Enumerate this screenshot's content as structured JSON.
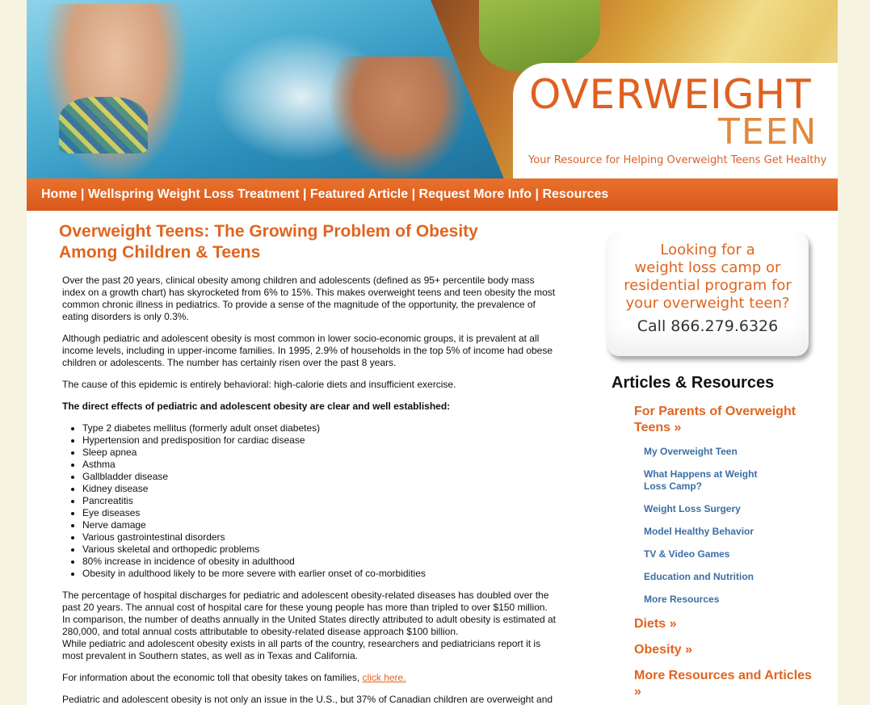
{
  "header": {
    "logo_title": "OVERWEIGHT",
    "logo_subtitle": "TEEN",
    "tagline": "Your Resource for Helping Overweight Teens Get Healthy"
  },
  "nav": {
    "items": [
      "Home",
      "Wellspring Weight Loss Treatment",
      "Featured Article",
      "Request More Info",
      "Resources"
    ],
    "separator": "|"
  },
  "main": {
    "title": "Overweight Teens: The Growing Problem of Obesity Among Children & Teens",
    "p1": "Over the past 20 years, clinical obesity among children and adolescents (defined as 95+ percentile body mass index on a growth chart) has skyrocketed from 6% to 15%. This makes overweight teens and teen obesity the most common chronic illness in pediatrics. To provide a sense of the magnitude of the opportunity, the prevalence of eating disorders is only 0.3%.",
    "p2": "Although pediatric and adolescent obesity is most common in lower socio-economic groups, it is prevalent at all income levels, including in upper-income families. In 1995, 2.9% of households in the top 5% of income had obese children or adolescents. The number has certainly risen over the past 8 years.",
    "p3": "The cause of this epidemic is entirely behavioral: high-calorie diets and insufficient exercise.",
    "list_lead": "The direct effects of pediatric and adolescent obesity are clear and well established:",
    "effects": [
      "Type 2 diabetes mellitus (formerly adult onset diabetes)",
      "Hypertension and predisposition for cardiac disease",
      "Sleep apnea",
      "Asthma",
      "Gallbladder disease",
      "Kidney disease",
      "Pancreatitis",
      "Eye diseases",
      "Nerve damage",
      "Various gastrointestinal disorders",
      "Various skeletal and orthopedic problems",
      "80% increase in incidence of obesity in adulthood",
      "Obesity in adulthood likely to be more severe with earlier onset of co-morbidities"
    ],
    "p4a": "The percentage of hospital discharges for pediatric and adolescent obesity-related diseases has doubled over the past 20 years. The annual cost of hospital care for these young people has more than tripled to over $150 million. In comparison, the number of deaths annually in the United States directly attributed to adult obesity is estimated at 280,000, and total annual costs attributable to obesity-related disease approach $100 billion.",
    "p4b": "While pediatric and adolescent obesity exists in all parts of the country, researchers and pediatricians report it is most prevalent in Southern states, as well as in Texas and California.",
    "p5_text": "For information about the economic toll that obesity takes on families,",
    "p5_link": "click here.",
    "p6": "Pediatric and adolescent obesity is not only an issue in the U.S., but 37% of Canadian children are overweight and"
  },
  "sidebar": {
    "promo_lines": [
      "Looking for a",
      "weight loss camp or",
      "residential program for",
      "your overweight teen?"
    ],
    "promo_phone": "Call 866.279.6326",
    "title": "Articles & Resources",
    "parents_heading": "For Parents of Overweight Teens »",
    "parents_links": [
      "My Overweight Teen",
      "What Happens at Weight Loss Camp?",
      "Weight Loss Surgery",
      "Model Healthy Behavior",
      "TV & Video Games",
      "Education and Nutrition",
      "More Resources"
    ],
    "diets_heading": "Diets »",
    "obesity_heading": "Obesity »",
    "more_heading": "More Resources and Articles »"
  },
  "colors": {
    "accent": "#e0651f",
    "nav_bg": "#d9591b",
    "link_blue": "#3c6ea5",
    "page_bg": "#f6f3e1"
  }
}
